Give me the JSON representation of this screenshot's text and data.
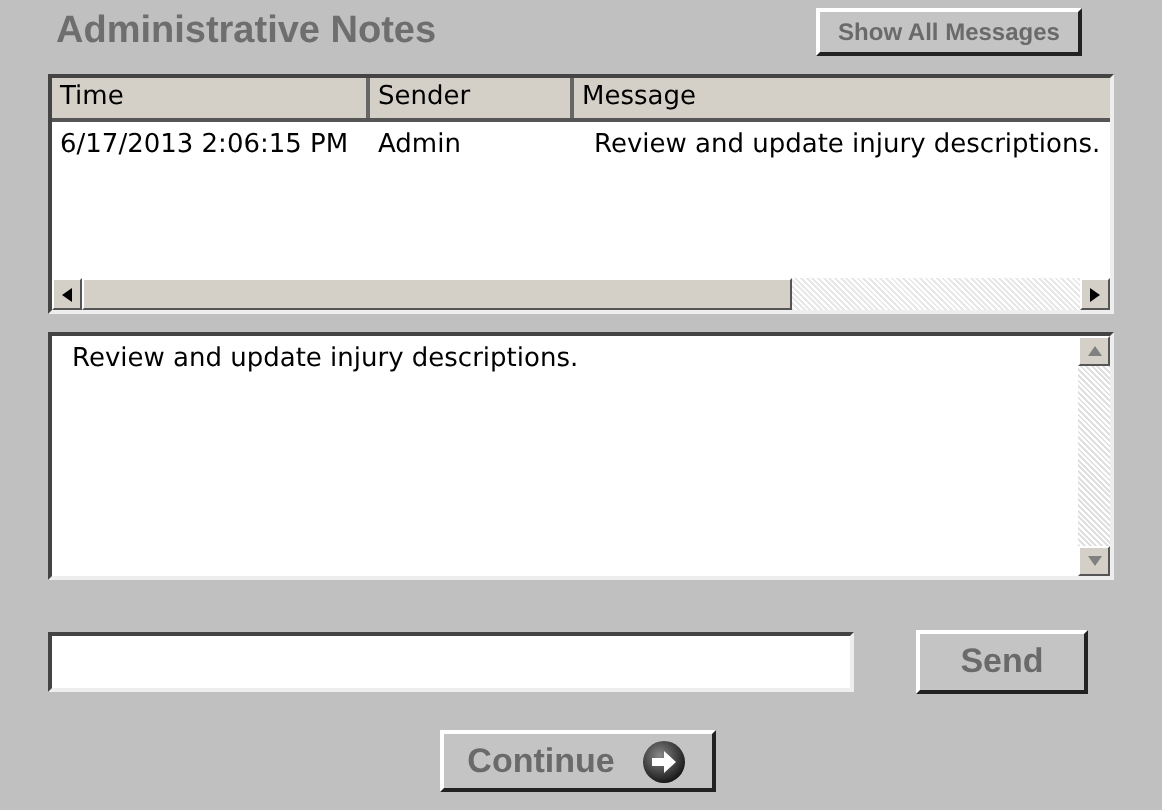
{
  "title": "Administrative Notes",
  "show_all_button": "Show All Messages",
  "table": {
    "columns": [
      "Time",
      "Sender",
      "Message"
    ],
    "rows": [
      {
        "cells": [
          "6/17/2013 2:06:15 PM",
          "Admin",
          "Review and update injury descriptions."
        ],
        "selected": false
      }
    ]
  },
  "message_view": {
    "text": "Review and update injury descriptions."
  },
  "send_button": "Send",
  "continue_button": "Continue"
}
